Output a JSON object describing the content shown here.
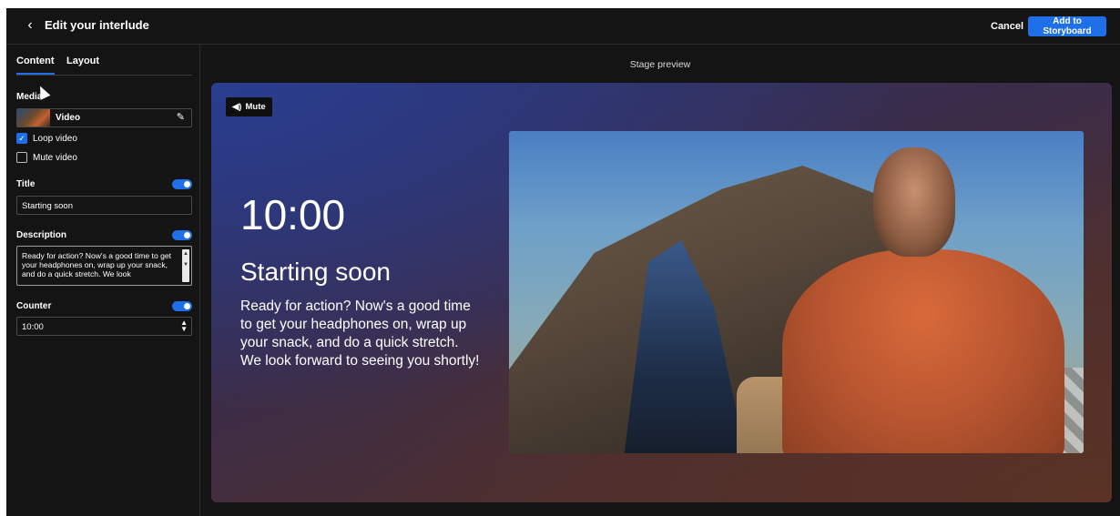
{
  "header": {
    "title": "Edit your interlude",
    "cancel_label": "Cancel",
    "add_label": "Add to Storyboard"
  },
  "tabs": {
    "content": "Content",
    "layout": "Layout"
  },
  "media": {
    "section_label": "Media",
    "type_label": "Video",
    "loop_label": "Loop video",
    "loop_checked": true,
    "mute_label": "Mute video",
    "mute_checked": false
  },
  "title_field": {
    "label": "Title",
    "value": "Starting soon",
    "enabled": true
  },
  "description_field": {
    "label": "Description",
    "value": "Ready for action? Now's a good time to get your headphones on, wrap up your snack, and do a quick stretch. We look",
    "enabled": true
  },
  "counter_field": {
    "label": "Counter",
    "value": "10:00",
    "enabled": true
  },
  "stage": {
    "heading": "Stage preview",
    "mute_button": "Mute",
    "counter": "10:00",
    "title": "Starting soon",
    "description": "Ready for action? Now's a good time to get your headphones on, wrap up your snack, and do a quick stretch. We look forward to seeing you shortly!"
  },
  "colors": {
    "accent": "#1f6fe8",
    "background": "#141414"
  },
  "icons": {
    "back": "chevron-left-icon",
    "edit": "pencil-icon",
    "mute": "speaker-icon"
  }
}
